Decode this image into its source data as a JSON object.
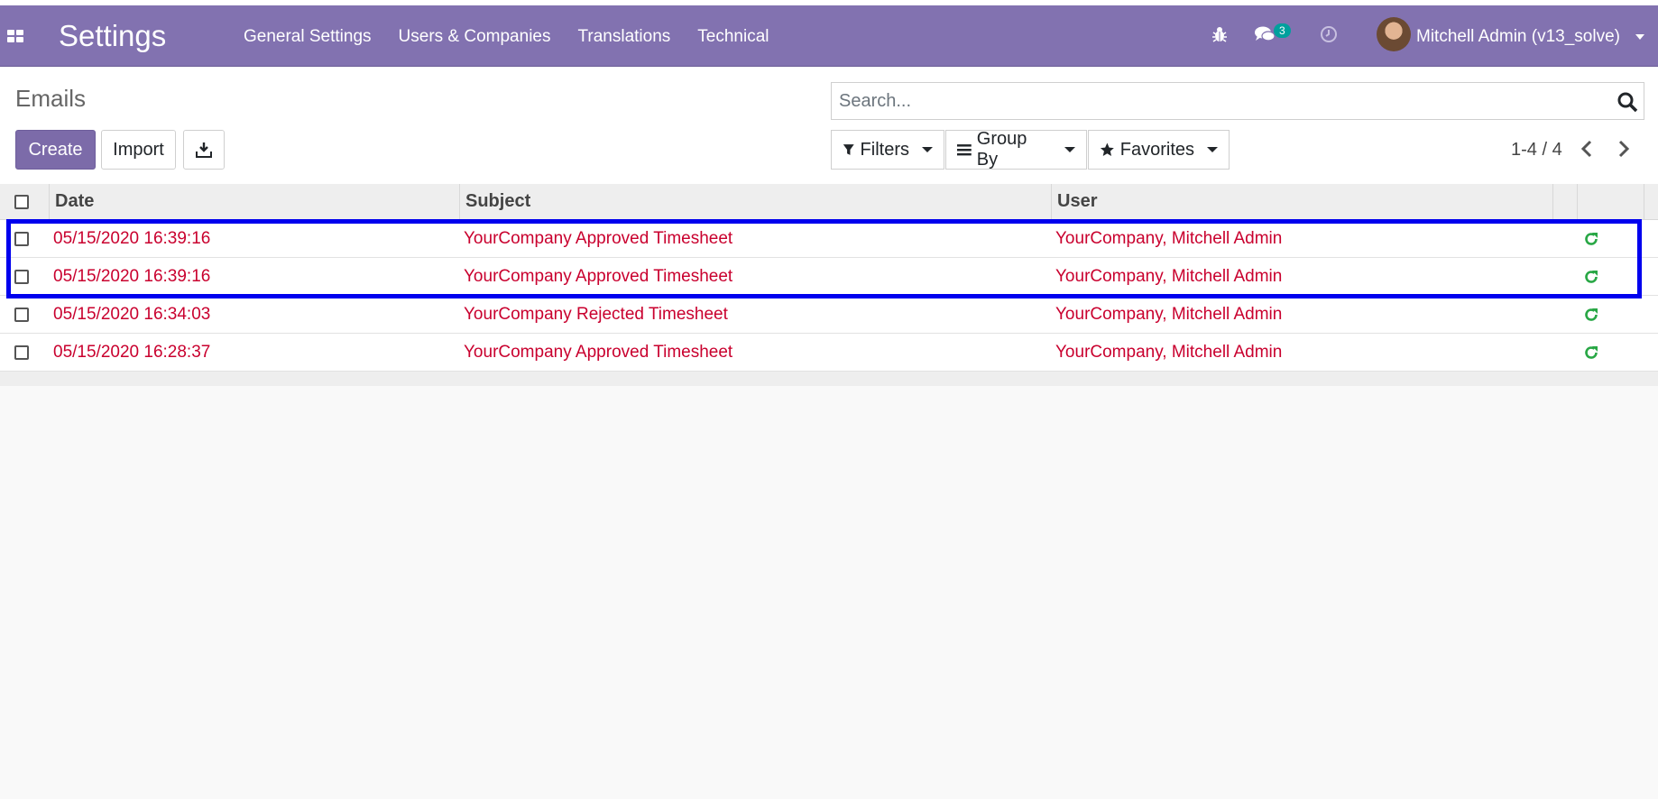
{
  "navbar": {
    "app_title": "Settings",
    "menu": [
      "General Settings",
      "Users & Companies",
      "Translations",
      "Technical"
    ],
    "messages_badge": "3",
    "user_name": "Mitchell Admin (v13_solve)",
    "icons": [
      "apps-icon",
      "bug-icon",
      "chat-icon",
      "clock-icon",
      "user-avatar"
    ]
  },
  "control_panel": {
    "breadcrumb": "Emails",
    "create_label": "Create",
    "import_label": "Import",
    "search_placeholder": "Search...",
    "filters_label": "Filters",
    "groupby_label": "Group By",
    "favorites_label": "Favorites",
    "pager": "1-4 / 4"
  },
  "table": {
    "columns": [
      "Date",
      "Subject",
      "User"
    ],
    "rows": [
      {
        "date": "05/15/2020 16:39:16",
        "subject": "YourCompany Approved Timesheet",
        "user": "YourCompany, Mitchell Admin"
      },
      {
        "date": "05/15/2020 16:39:16",
        "subject": "YourCompany Approved Timesheet",
        "user": "YourCompany, Mitchell Admin"
      },
      {
        "date": "05/15/2020 16:34:03",
        "subject": "YourCompany Rejected Timesheet",
        "user": "YourCompany, Mitchell Admin"
      },
      {
        "date": "05/15/2020 16:28:37",
        "subject": "YourCompany Approved Timesheet",
        "user": "YourCompany, Mitchell Admin"
      }
    ]
  },
  "colors": {
    "navbar": "#8272b0",
    "primary_button": "#7c6ba9",
    "row_text": "#c9002e",
    "retry_icon": "#28a745",
    "highlight_box": "#0000ee"
  }
}
